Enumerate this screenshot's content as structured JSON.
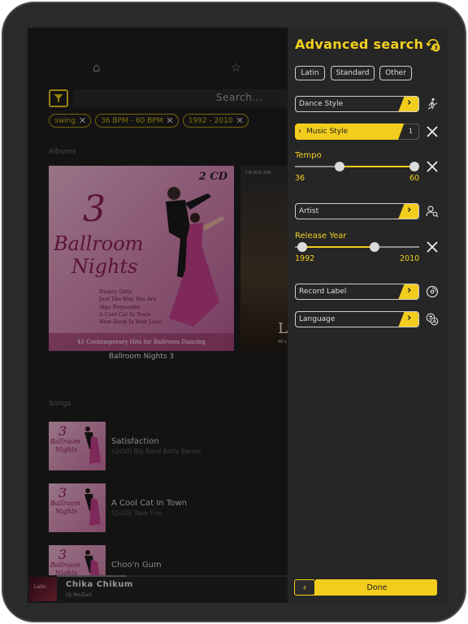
{
  "icons": {
    "home": "home-icon",
    "favorites": "star-icon",
    "filter": "filter-funnel-icon",
    "chip_remove": "close-icon",
    "reset": "reset-refresh-icon",
    "dance_style": "dancer-icon",
    "music_style_clear": "close-icon",
    "artist": "person-search-icon",
    "record_label": "vinyl-record-icon",
    "language": "translate-icon"
  },
  "colors": {
    "accent": "#f2cd1e",
    "panel_bg": "#262626",
    "screen_bg": "#1e1e1e"
  },
  "search": {
    "placeholder": "Search..."
  },
  "active_filters": [
    {
      "label": "swing"
    },
    {
      "label": "36 BPM - 60 BPM"
    },
    {
      "label": "1992 - 2010"
    }
  ],
  "albums_section": {
    "label": "Albums",
    "items": [
      {
        "title": "Ballroom Nights 3",
        "cover": {
          "badge": "2 CD",
          "number": "3",
          "line1": "Ballroom",
          "line2": "Nights",
          "tracks": [
            "Disney Girls",
            "Just The Way You Are",
            "Algo Pequenito",
            "A Cool Cat In Town",
            "How Deep Is Your Love"
          ],
          "footer": "41 Contemporary Hits for Ballroom Dancing"
        }
      },
      {
        "cover": {
          "label": "CM DCD 500",
          "letter": "L",
          "small": "40 s"
        }
      }
    ]
  },
  "songs_section": {
    "label": "Songs",
    "items": [
      {
        "title": "Satisfaction",
        "subtitle": "(Qs50) Big Band Batty Bernie"
      },
      {
        "title": "A Cool Cat In Town",
        "subtitle": "(Qs50) Tape Five"
      },
      {
        "title": "Choo'n Gum",
        "subtitle": ""
      }
    ],
    "thumb_art": {
      "number": "3",
      "line1": "Ballroom",
      "line2": "Nights"
    }
  },
  "now_playing": {
    "title": "Chika Chikum",
    "artist": "DJ MoZart",
    "thumb_text": "Latin",
    "progress": 0.3
  },
  "panel": {
    "title": "Advanced search",
    "reset_count": "3",
    "tags": [
      "Latin",
      "Standard",
      "Other"
    ],
    "dance_style": {
      "label": "Dance Style"
    },
    "music_style": {
      "label": "Music Style",
      "count": "1"
    },
    "tempo": {
      "label": "Tempo",
      "min_label": "36",
      "max_label": "60",
      "low": 0.36,
      "high": 0.96
    },
    "artist": {
      "label": "Artist"
    },
    "release_year": {
      "label": "Release Year",
      "min_label": "1992",
      "max_label": "2010",
      "low": 0.06,
      "high": 0.64
    },
    "record_label": {
      "label": "Record Label"
    },
    "language": {
      "label": "Language"
    },
    "done_label": "Done"
  }
}
